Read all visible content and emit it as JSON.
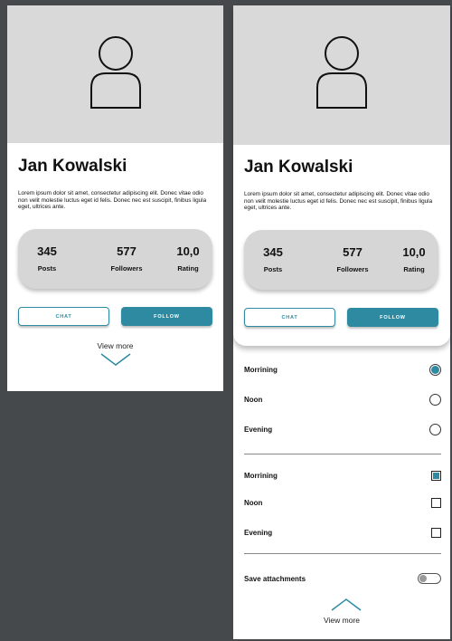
{
  "profile": {
    "name": "Jan Kowalski",
    "bio": "Lorem ipsum dolor sit amet, consectetur adipiscing elit. Donec vitae odio non velit molestie luctus eget id felis. Donec nec est suscipit, finibus ligula eget, ultrices ante.",
    "stats": [
      {
        "value": "345",
        "label": "Posts"
      },
      {
        "value": "577",
        "label": "Followers"
      },
      {
        "value": "10,0",
        "label": "Rating"
      }
    ],
    "chat_label": "CHAT",
    "follow_label": "FOLLOW",
    "view_more": "View more"
  },
  "options": {
    "radio_group": [
      {
        "label": "Morrining",
        "selected": true
      },
      {
        "label": "Noon",
        "selected": false
      },
      {
        "label": "Evening",
        "selected": false
      }
    ],
    "checkbox_group": [
      {
        "label": "Morrining",
        "checked": true
      },
      {
        "label": "Noon",
        "checked": false
      },
      {
        "label": "Evening",
        "checked": false
      }
    ],
    "save_attachments": {
      "label": "Save attachments",
      "on": false
    },
    "view_more": "View more"
  },
  "colors": {
    "accent": "#2e8aa0",
    "background": "#46494c",
    "avatar_bg": "#d9d9d9",
    "stats_bg": "#d6d6d6"
  },
  "icons": {
    "avatar": "user-silhouette-icon",
    "expand": "chevron-down-icon",
    "collapse": "chevron-up-icon"
  }
}
